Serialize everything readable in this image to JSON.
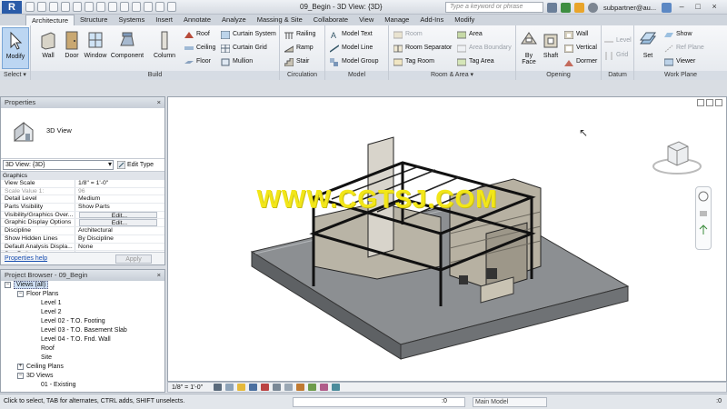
{
  "window": {
    "app_logo": "R",
    "title": "09_Begin - 3D View: {3D}",
    "search_placeholder": "Type a keyword or phrase",
    "username": "subpartner@au...",
    "minimize": "–",
    "maximize": "□",
    "close": "×"
  },
  "ribbon": {
    "tabs": [
      "Architecture",
      "Structure",
      "Systems",
      "Insert",
      "Annotate",
      "Analyze",
      "Massing & Site",
      "Collaborate",
      "View",
      "Manage",
      "Add-Ins",
      "Modify"
    ],
    "active_tab": "Architecture",
    "panels": {
      "select": "Select ▾",
      "build": "Build",
      "circulation": "Circulation",
      "model": "Model",
      "room_area": "Room & Area ▾",
      "opening": "Opening",
      "datum": "Datum",
      "work_plane": "Work Plane"
    },
    "buttons": {
      "modify": "Modify",
      "wall": "Wall",
      "door": "Door",
      "window": "Window",
      "component": "Component",
      "column": "Column",
      "roof": "Roof",
      "ceiling": "Ceiling",
      "floor": "Floor",
      "curtain_system": "Curtain System",
      "curtain_grid": "Curtain Grid",
      "mullion": "Mullion",
      "railing": "Railing",
      "ramp": "Ramp",
      "stair": "Stair",
      "model_text": "Model Text",
      "model_line": "Model Line",
      "model_group": "Model Group",
      "room": "Room",
      "room_separator": "Room Separator",
      "tag_room": "Tag Room",
      "area": "Area",
      "area_boundary": "Area Boundary",
      "tag_area": "Tag Area",
      "by_face": "By Face",
      "shaft": "Shaft",
      "wall_opening": "Wall",
      "vertical": "Vertical",
      "dormer": "Dormer",
      "level": "Level",
      "grid": "Grid",
      "set": "Set",
      "show": "Show",
      "ref_plane": "Ref Plane",
      "viewer": "Viewer"
    }
  },
  "properties": {
    "title": "Properties",
    "close": "×",
    "type_name": "3D View",
    "instance_selector": "3D View: {3D}",
    "edit_type": "Edit Type",
    "group": "Graphics",
    "rows": [
      {
        "key": "View Scale",
        "value": "1/8\" = 1'-0\""
      },
      {
        "key": "Scale Value    1:",
        "value": "96"
      },
      {
        "key": "Detail Level",
        "value": "Medium"
      },
      {
        "key": "Parts Visibility",
        "value": "Show Parts"
      },
      {
        "key": "Visibility/Graphics Over...",
        "value": "Edit..."
      },
      {
        "key": "Graphic Display Options",
        "value": "Edit..."
      },
      {
        "key": "Discipline",
        "value": "Architectural"
      },
      {
        "key": "Show Hidden Lines",
        "value": "By Discipline"
      },
      {
        "key": "Default Analysis Displa...",
        "value": "None"
      },
      {
        "key": "Sun Path",
        "value": ""
      }
    ],
    "help_link": "Properties help",
    "apply": "Apply"
  },
  "browser": {
    "title": "Project Browser - 09_Begin",
    "close": "×",
    "nodes": {
      "views": "Views (all)",
      "floor_plans": "Floor Plans",
      "level1": "Level 1",
      "level2": "Level 2",
      "level02": "Level 02 - T.O. Footing",
      "level03": "Level 03 - T.O. Basement Slab",
      "level04": "Level 04 - T.O. Fnd. Wall",
      "roof": "Roof",
      "site": "Site",
      "ceiling_plans": "Ceiling Plans",
      "views_3d": "3D Views",
      "existing": "01 - Existing"
    }
  },
  "viewport": {
    "watermark": "WWW.CGTSJ.COM",
    "view_scale": "1/8\" = 1'-0\""
  },
  "status": {
    "message": "Click to select, TAB for alternates, CTRL adds, SHIFT unselects.",
    "counter": ":0",
    "model_select": "Main Model",
    "filter_count": ":0"
  },
  "colors": {
    "accent": "#2a5ba8",
    "watermark": "#f2e619",
    "selected_tool": "#bcd6f2"
  }
}
